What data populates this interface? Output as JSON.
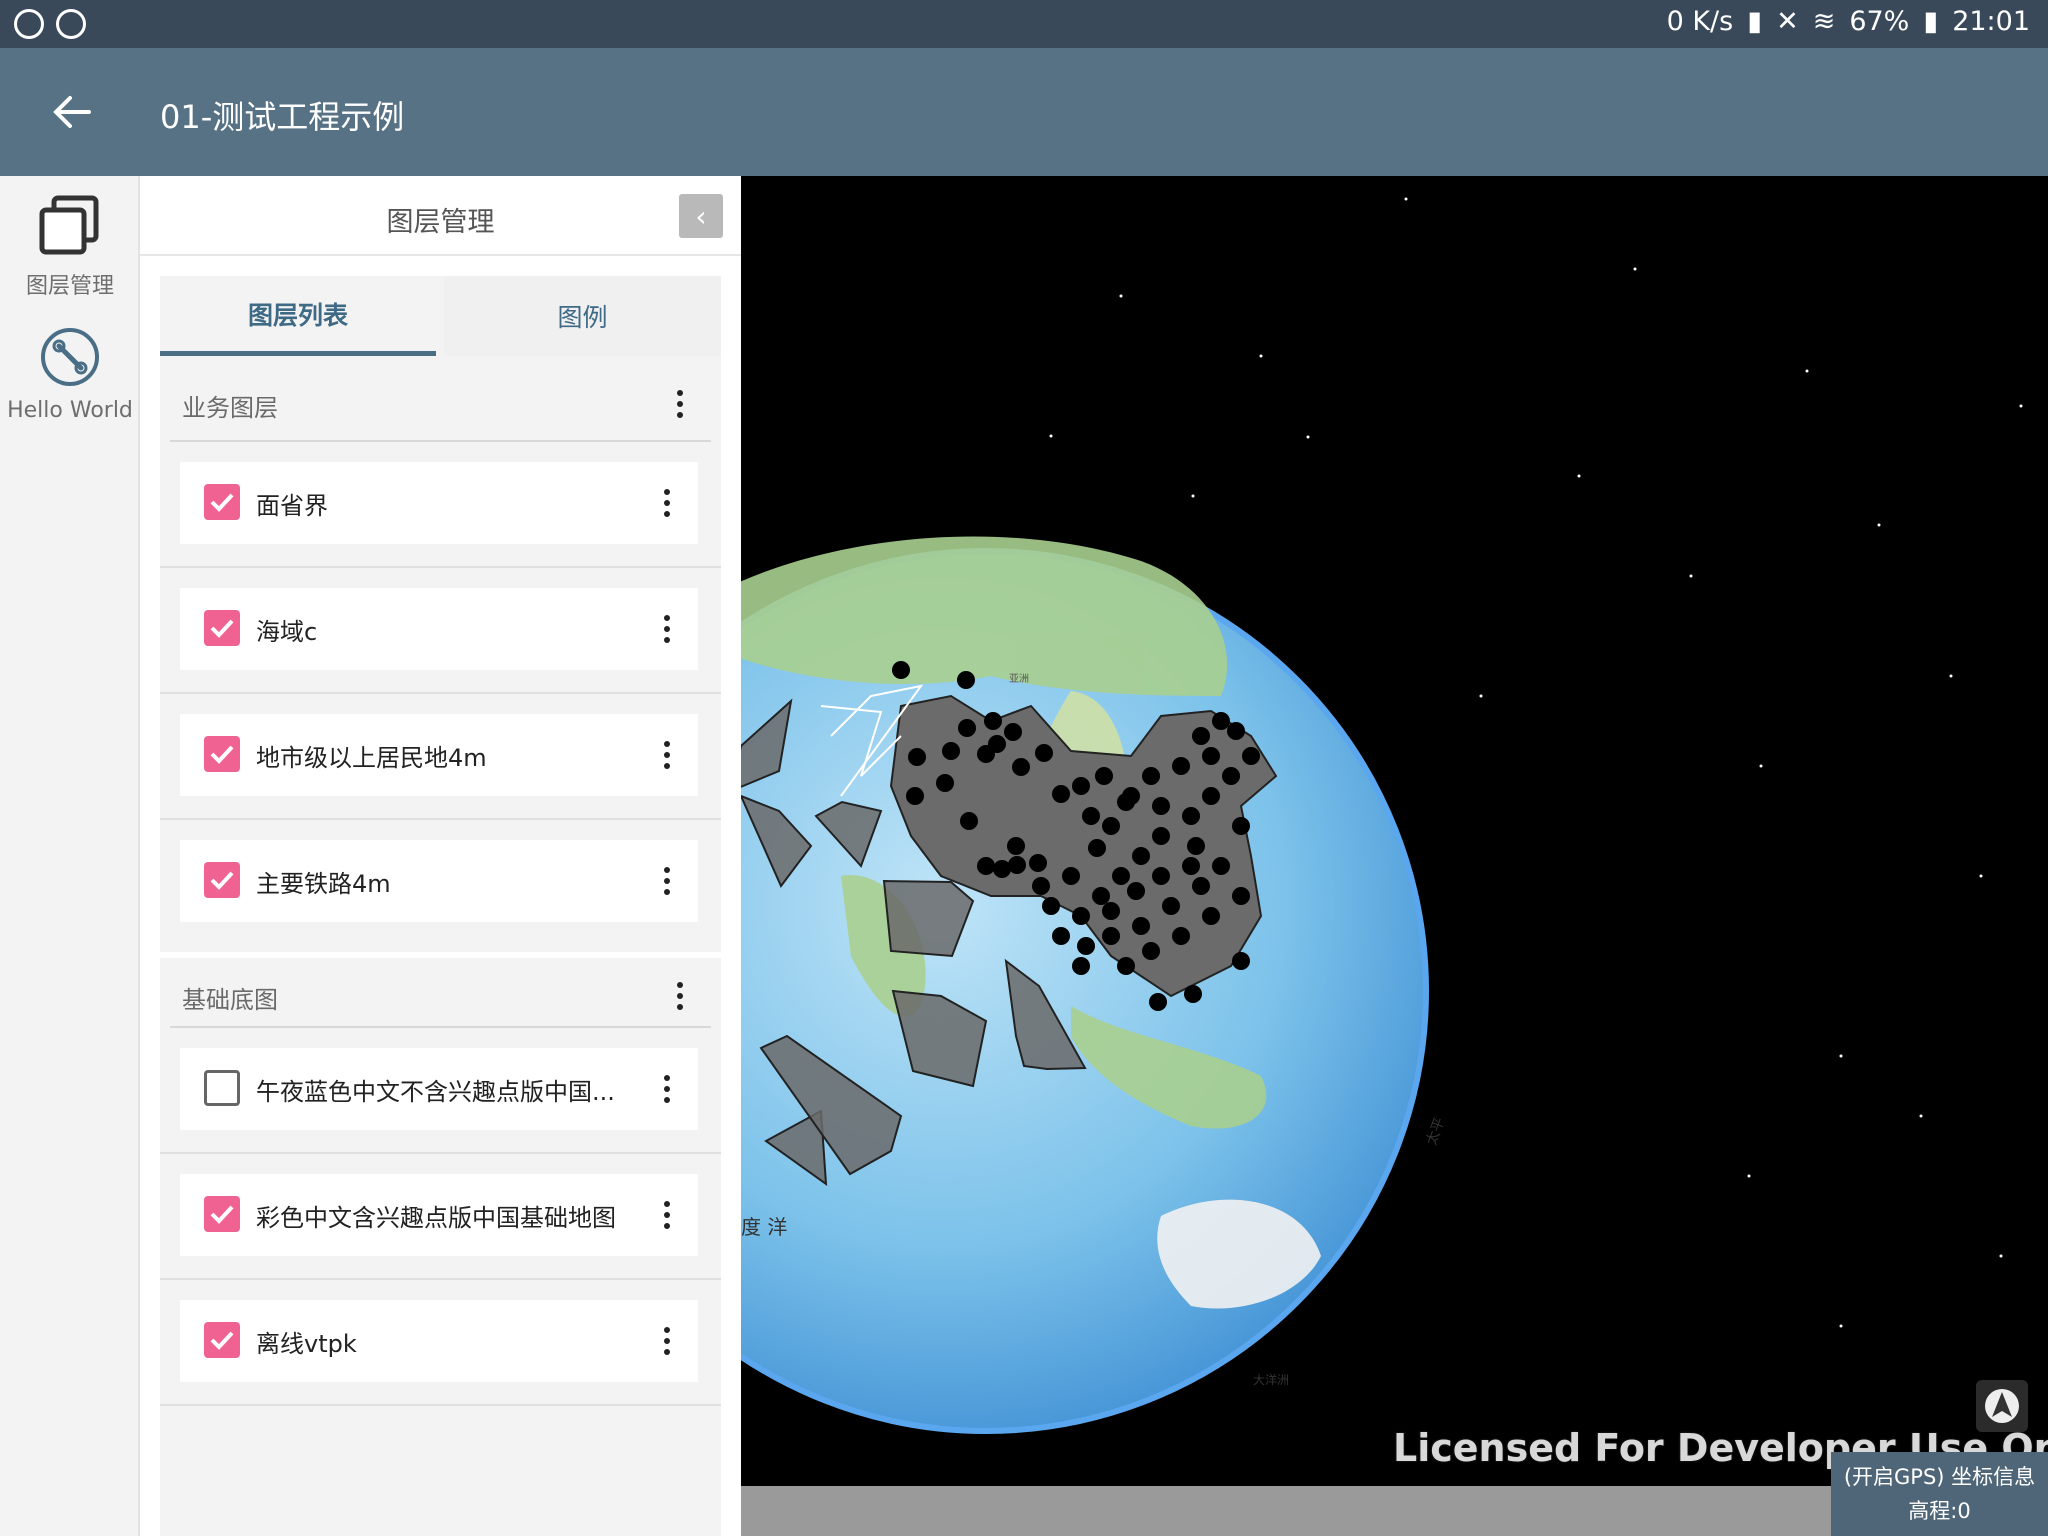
{
  "status_bar": {
    "network_speed": "0 K/s",
    "battery": "67%",
    "time": "21:01"
  },
  "app_bar": {
    "title": "01-测试工程示例"
  },
  "nav_rail": {
    "items": [
      {
        "label": "图层管理",
        "icon": "layers-icon"
      },
      {
        "label": "Hello World",
        "icon": "wrench-icon"
      }
    ]
  },
  "panel": {
    "title": "图层管理",
    "tabs": [
      {
        "label": "图层列表",
        "active": true
      },
      {
        "label": "图例",
        "active": false
      }
    ],
    "groups": [
      {
        "name": "业务图层",
        "layers": [
          {
            "name": "面省界",
            "checked": true
          },
          {
            "name": "海域c",
            "checked": true
          },
          {
            "name": "地市级以上居民地4m",
            "checked": true
          },
          {
            "name": "主要铁路4m",
            "checked": true
          }
        ]
      },
      {
        "name": "基础底图",
        "layers": [
          {
            "name": "午夜蓝色中文不含兴趣点版中国...",
            "checked": false
          },
          {
            "name": "彩色中文含兴趣点版中国基础地图",
            "checked": true
          },
          {
            "name": "离线vtpk",
            "checked": true
          }
        ]
      }
    ]
  },
  "map": {
    "watermark": "Licensed For Developer Use Only",
    "coord_info": "(开启GPS) 坐标信息",
    "elevation": "高程:0",
    "labels": {
      "asia": "亚洲",
      "indian_ocean": "度 洋",
      "pacific": "太平",
      "antarctic": "大洋洲"
    }
  }
}
